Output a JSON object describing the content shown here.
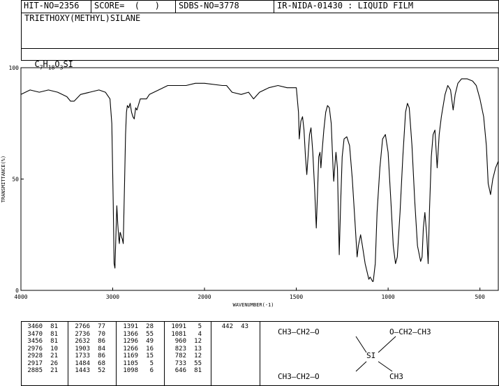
{
  "header": {
    "hit": "HIT-NO=2356",
    "score": "SCORE=  (   )",
    "sdbs": "SDBS-NO=3778",
    "method": "IR-NIDA-01430 : LIQUID FILM"
  },
  "compound": {
    "name": "TRIETHOXY(METHYL)SILANE",
    "formula_parts": [
      "C",
      "7",
      "H",
      "18",
      "O",
      "3",
      "SI"
    ]
  },
  "chart_data": {
    "type": "line",
    "xlabel": "WAVENUMBER(-1)",
    "ylabel": "TRANSMITTANCE(%)",
    "xlim": [
      4000,
      400
    ],
    "ylim": [
      0,
      100
    ],
    "x_ticks": [
      4000,
      3000,
      2000,
      1500,
      1000,
      500
    ],
    "y_ticks": [
      0,
      50,
      100
    ],
    "grid": false,
    "series": [
      {
        "points": [
          [
            4000,
            88
          ],
          [
            3900,
            90
          ],
          [
            3800,
            89
          ],
          [
            3700,
            90
          ],
          [
            3600,
            89
          ],
          [
            3500,
            87
          ],
          [
            3460,
            85
          ],
          [
            3420,
            85
          ],
          [
            3350,
            88
          ],
          [
            3250,
            89
          ],
          [
            3150,
            90
          ],
          [
            3080,
            89
          ],
          [
            3030,
            86
          ],
          [
            3010,
            75
          ],
          [
            2995,
            40
          ],
          [
            2985,
            12
          ],
          [
            2976,
            10
          ],
          [
            2965,
            25
          ],
          [
            2955,
            38
          ],
          [
            2945,
            30
          ],
          [
            2935,
            24
          ],
          [
            2928,
            21
          ],
          [
            2920,
            26
          ],
          [
            2917,
            26
          ],
          [
            2905,
            24
          ],
          [
            2895,
            23
          ],
          [
            2885,
            21
          ],
          [
            2870,
            50
          ],
          [
            2860,
            70
          ],
          [
            2850,
            80
          ],
          [
            2840,
            83
          ],
          [
            2825,
            82
          ],
          [
            2810,
            84
          ],
          [
            2795,
            80
          ],
          [
            2780,
            78
          ],
          [
            2766,
            77
          ],
          [
            2750,
            82
          ],
          [
            2736,
            81
          ],
          [
            2700,
            86
          ],
          [
            2632,
            86
          ],
          [
            2600,
            88
          ],
          [
            2500,
            90
          ],
          [
            2400,
            92
          ],
          [
            2300,
            92
          ],
          [
            2200,
            92
          ],
          [
            2100,
            93
          ],
          [
            2000,
            93
          ],
          [
            1903,
            92
          ],
          [
            1880,
            92
          ],
          [
            1850,
            89
          ],
          [
            1800,
            88
          ],
          [
            1760,
            89
          ],
          [
            1733,
            86
          ],
          [
            1700,
            89
          ],
          [
            1650,
            91
          ],
          [
            1600,
            92
          ],
          [
            1550,
            91
          ],
          [
            1500,
            91
          ],
          [
            1488,
            80
          ],
          [
            1484,
            68
          ],
          [
            1475,
            76
          ],
          [
            1466,
            78
          ],
          [
            1458,
            72
          ],
          [
            1450,
            60
          ],
          [
            1443,
            52
          ],
          [
            1436,
            60
          ],
          [
            1428,
            70
          ],
          [
            1420,
            73
          ],
          [
            1410,
            62
          ],
          [
            1400,
            45
          ],
          [
            1391,
            28
          ],
          [
            1384,
            45
          ],
          [
            1378,
            60
          ],
          [
            1371,
            62
          ],
          [
            1366,
            55
          ],
          [
            1360,
            62
          ],
          [
            1350,
            72
          ],
          [
            1340,
            80
          ],
          [
            1330,
            83
          ],
          [
            1320,
            82
          ],
          [
            1310,
            75
          ],
          [
            1300,
            55
          ],
          [
            1296,
            49
          ],
          [
            1290,
            56
          ],
          [
            1284,
            62
          ],
          [
            1276,
            55
          ],
          [
            1266,
            16
          ],
          [
            1258,
            40
          ],
          [
            1250,
            60
          ],
          [
            1240,
            68
          ],
          [
            1225,
            69
          ],
          [
            1210,
            65
          ],
          [
            1195,
            50
          ],
          [
            1180,
            30
          ],
          [
            1169,
            15
          ],
          [
            1162,
            20
          ],
          [
            1150,
            25
          ],
          [
            1140,
            20
          ],
          [
            1125,
            12
          ],
          [
            1105,
            5
          ],
          [
            1098,
            6
          ],
          [
            1091,
            5
          ],
          [
            1085,
            4
          ],
          [
            1081,
            4
          ],
          [
            1070,
            12
          ],
          [
            1060,
            35
          ],
          [
            1045,
            55
          ],
          [
            1030,
            68
          ],
          [
            1015,
            70
          ],
          [
            1000,
            62
          ],
          [
            985,
            40
          ],
          [
            972,
            20
          ],
          [
            960,
            12
          ],
          [
            950,
            15
          ],
          [
            935,
            35
          ],
          [
            920,
            60
          ],
          [
            905,
            80
          ],
          [
            895,
            84
          ],
          [
            885,
            82
          ],
          [
            870,
            65
          ],
          [
            855,
            40
          ],
          [
            840,
            20
          ],
          [
            823,
            13
          ],
          [
            815,
            15
          ],
          [
            808,
            28
          ],
          [
            800,
            35
          ],
          [
            790,
            25
          ],
          [
            782,
            12
          ],
          [
            775,
            35
          ],
          [
            765,
            60
          ],
          [
            755,
            70
          ],
          [
            745,
            72
          ],
          [
            733,
            55
          ],
          [
            722,
            70
          ],
          [
            710,
            78
          ],
          [
            690,
            88
          ],
          [
            675,
            92
          ],
          [
            660,
            90
          ],
          [
            646,
            81
          ],
          [
            635,
            88
          ],
          [
            620,
            93
          ],
          [
            600,
            95
          ],
          [
            570,
            95
          ],
          [
            540,
            94
          ],
          [
            520,
            92
          ],
          [
            500,
            86
          ],
          [
            480,
            78
          ],
          [
            465,
            65
          ],
          [
            455,
            48
          ],
          [
            442,
            43
          ],
          [
            430,
            50
          ],
          [
            415,
            55
          ],
          [
            400,
            58
          ]
        ]
      }
    ]
  },
  "peaks": [
    [
      "3460",
      "81"
    ],
    [
      "3470",
      "81"
    ],
    [
      "3456",
      "81"
    ],
    [
      "2976",
      "10"
    ],
    [
      "2928",
      "21"
    ],
    [
      "2917",
      "26"
    ],
    [
      "2885",
      "21"
    ],
    [
      "2766",
      "77"
    ],
    [
      "2736",
      "70"
    ],
    [
      "2632",
      "86"
    ],
    [
      "1903",
      "84"
    ],
    [
      "1733",
      "86"
    ],
    [
      "1484",
      "68"
    ],
    [
      "1443",
      "52"
    ],
    [
      "1391",
      "28"
    ],
    [
      "1366",
      "55"
    ],
    [
      "1296",
      "49"
    ],
    [
      "1266",
      "16"
    ],
    [
      "1169",
      "15"
    ],
    [
      "1105",
      "5"
    ],
    [
      "1098",
      "6"
    ],
    [
      "1091",
      "5"
    ],
    [
      "1081",
      "4"
    ],
    [
      "960",
      "12"
    ],
    [
      "823",
      "13"
    ],
    [
      "782",
      "12"
    ],
    [
      "733",
      "55"
    ],
    [
      "646",
      "81"
    ],
    [
      "442",
      "43"
    ]
  ],
  "structure": {
    "top_left": "CH3—CH2—O",
    "top_right": "O—CH2—CH3",
    "center": "SI",
    "bottom_left": "CH3—CH2—O",
    "bottom_right": "CH3"
  }
}
